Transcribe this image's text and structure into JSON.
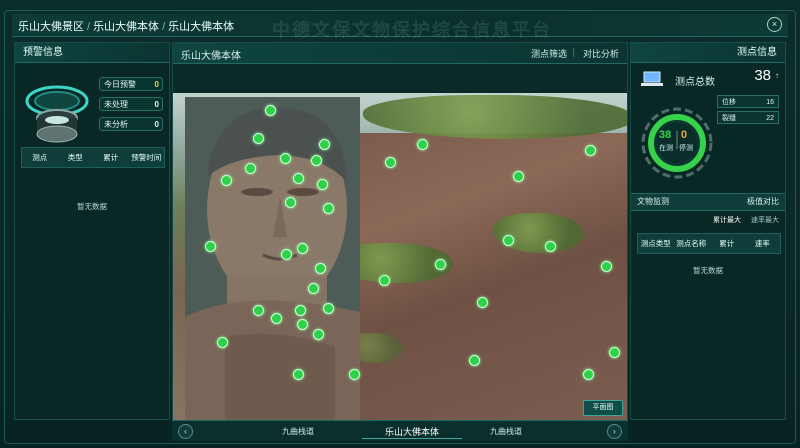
{
  "window": {
    "bg_title": "中德文保文物保护综合信息平台",
    "breadcrumbs": [
      "乐山大佛景区",
      "乐山大佛本体",
      "乐山大佛本体"
    ],
    "close_icon": "close-icon"
  },
  "left_panel": {
    "title": "预警信息",
    "rows": [
      {
        "label": "今日预警",
        "value": "0",
        "color": "#f2d64b"
      },
      {
        "label": "未处理",
        "value": "0",
        "color": "#d9ecea"
      },
      {
        "label": "未分析",
        "value": "0",
        "color": "#d9ecea"
      }
    ],
    "table_headers": [
      "测点",
      "类型",
      "累计",
      "预警时间"
    ],
    "empty_text": "暂无数据"
  },
  "center_panel": {
    "title": "乐山大佛本体",
    "actions": [
      "测点筛选",
      "对比分析"
    ],
    "map_button": "平面图",
    "bottom_nav": {
      "prev_label": "九曲栈道",
      "current_label": "乐山大佛本体",
      "next_label": "九曲栈道"
    }
  },
  "right_panel": {
    "title": "测点信息",
    "total_label": "测点总数",
    "total_value": "38",
    "gauge": {
      "online": "38",
      "offline": "0",
      "online_label": "在测",
      "offline_label": "停测"
    },
    "stats": [
      {
        "label": "位移",
        "value": "16"
      },
      {
        "label": "裂缝",
        "value": "22"
      }
    ],
    "section_left": "文物监测",
    "section_right": "极值对比",
    "sub_select": "累计最大",
    "sub_option": "速率最大",
    "table_headers": [
      "测点类型",
      "测点名称",
      "累计",
      "速率"
    ],
    "empty_text": "暂无数据"
  },
  "colors": {
    "accent": "#2fd14a",
    "panel": "#092825",
    "border": "#1f6a62"
  }
}
